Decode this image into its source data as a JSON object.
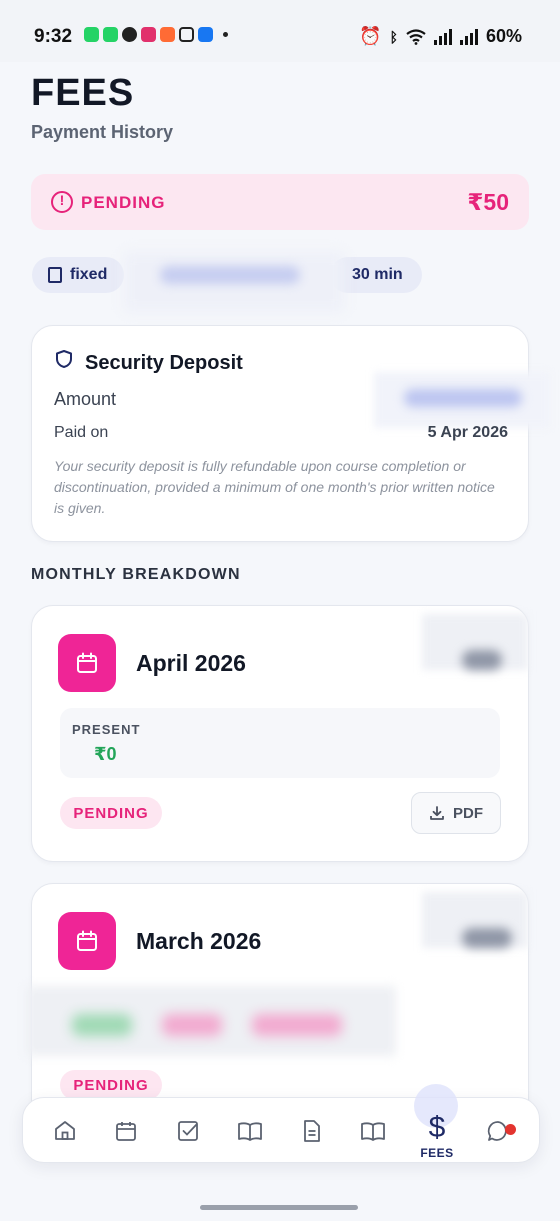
{
  "status_bar": {
    "time": "9:32",
    "battery": "60%",
    "app_icon_colors": [
      "#25d366",
      "#25d366",
      "#222222",
      "#e1306c",
      "#ff6b35",
      "#222222",
      "#1877f2"
    ]
  },
  "header": {
    "title": "FEES",
    "subtitle": "Payment History"
  },
  "pending_banner": {
    "status": "PENDING",
    "amount": "₹50",
    "color": "#e6237a"
  },
  "chips": {
    "plan": "fixed",
    "duration": "30 min"
  },
  "security_deposit": {
    "title": "Security Deposit",
    "amount_label": "Amount",
    "paid_on_label": "Paid on",
    "paid_on_value": "5 Apr 2026",
    "note": "Your security deposit is fully refundable upon course completion or discontinuation, provided a minimum of one month's prior written notice is given."
  },
  "breakdown": {
    "heading": "MONTHLY BREAKDOWN",
    "months": [
      {
        "name": "April 2026",
        "present_label": "PRESENT",
        "present_value": "₹0",
        "status": "PENDING",
        "pdf_label": "PDF"
      },
      {
        "name": "March 2026",
        "status": "PENDING"
      }
    ]
  },
  "bottom_nav": {
    "items": [
      "home-icon",
      "calendar-icon",
      "checkbox-icon",
      "book-open-icon",
      "document-icon",
      "book-icon",
      "dollar-icon",
      "chat-icon"
    ],
    "active_label": "FEES",
    "active_symbol": "$",
    "accent": "#1f2a66"
  }
}
